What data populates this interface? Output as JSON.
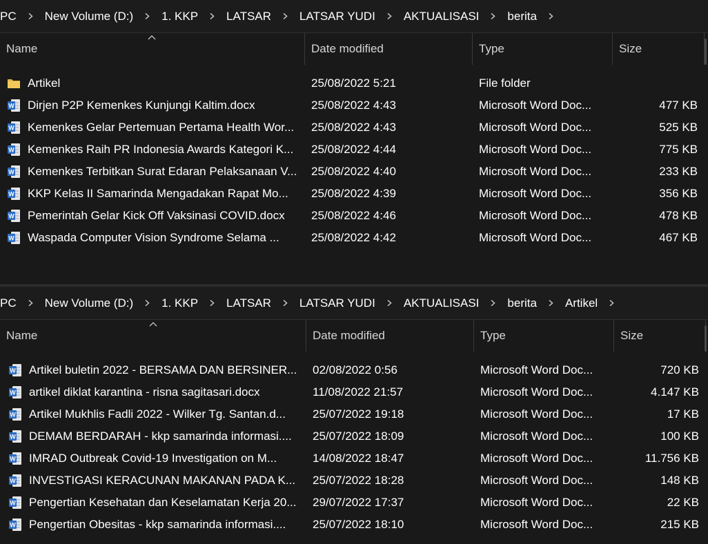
{
  "top_pane": {
    "breadcrumb": [
      "PC",
      "New Volume (D:)",
      "1. KKP",
      "LATSAR",
      "LATSAR YUDI",
      "AKTUALISASI",
      "berita"
    ],
    "columns": {
      "name": "Name",
      "date": "Date modified",
      "type": "Type",
      "size": "Size"
    },
    "rows": [
      {
        "icon": "folder-icon",
        "name": "Artikel",
        "date": "25/08/2022 5:21",
        "type": "File folder",
        "size": ""
      },
      {
        "icon": "word-doc-icon",
        "name": "Dirjen P2P Kemenkes Kunjungi Kaltim.docx",
        "date": "25/08/2022 4:43",
        "type": "Microsoft Word Doc...",
        "size": "477 KB"
      },
      {
        "icon": "word-doc-icon",
        "name": "Kemenkes Gelar Pertemuan Pertama Health Wor...",
        "date": "25/08/2022 4:43",
        "type": "Microsoft Word Doc...",
        "size": "525 KB"
      },
      {
        "icon": "word-doc-icon",
        "name": "Kemenkes Raih PR Indonesia Awards Kategori K...",
        "date": "25/08/2022 4:44",
        "type": "Microsoft Word Doc...",
        "size": "775 KB"
      },
      {
        "icon": "word-doc-icon",
        "name": "Kemenkes Terbitkan Surat Edaran Pelaksanaan V...",
        "date": "25/08/2022 4:40",
        "type": "Microsoft Word Doc...",
        "size": "233 KB"
      },
      {
        "icon": "word-doc-icon",
        "name": "KKP Kelas II Samarinda Mengadakan Rapat Mo...",
        "date": "25/08/2022 4:39",
        "type": "Microsoft Word Doc...",
        "size": "356 KB"
      },
      {
        "icon": "word-doc-icon",
        "name": "Pemerintah Gelar Kick Off Vaksinasi COVID.docx",
        "date": "25/08/2022 4:46",
        "type": "Microsoft Word Doc...",
        "size": "478 KB"
      },
      {
        "icon": "word-doc-icon",
        "name": "Waspada Computer Vision Syndrome Selama ...",
        "date": "25/08/2022 4:42",
        "type": "Microsoft Word Doc...",
        "size": "467 KB"
      }
    ]
  },
  "bottom_pane": {
    "breadcrumb": [
      "PC",
      "New Volume (D:)",
      "1. KKP",
      "LATSAR",
      "LATSAR YUDI",
      "AKTUALISASI",
      "berita",
      "Artikel"
    ],
    "columns": {
      "name": "Name",
      "date": "Date modified",
      "type": "Type",
      "size": "Size"
    },
    "rows": [
      {
        "icon": "word-doc-icon",
        "name": "Artikel buletin 2022 - BERSAMA DAN BERSINER...",
        "date": "02/08/2022 0:56",
        "type": "Microsoft Word Doc...",
        "size": "720 KB"
      },
      {
        "icon": "word-doc-icon",
        "name": "artikel diklat karantina - risna sagitasari.docx",
        "date": "11/08/2022 21:57",
        "type": "Microsoft Word Doc...",
        "size": "4.147 KB"
      },
      {
        "icon": "word-doc-icon",
        "name": "Artikel Mukhlis Fadli 2022 - Wilker Tg. Santan.d...",
        "date": "25/07/2022 19:18",
        "type": "Microsoft Word Doc...",
        "size": "17 KB"
      },
      {
        "icon": "word-doc-icon",
        "name": "DEMAM BERDARAH - kkp samarinda informasi....",
        "date": "25/07/2022 18:09",
        "type": "Microsoft Word Doc...",
        "size": "100 KB"
      },
      {
        "icon": "word-doc-icon",
        "name": "IMRAD Outbreak Covid-19 Investigation on M...",
        "date": "14/08/2022 18:47",
        "type": "Microsoft Word Doc...",
        "size": "11.756 KB"
      },
      {
        "icon": "word-doc-icon",
        "name": "INVESTIGASI KERACUNAN MAKANAN PADA K...",
        "date": "25/07/2022 18:28",
        "type": "Microsoft Word Doc...",
        "size": "148 KB"
      },
      {
        "icon": "word-doc-icon",
        "name": "Pengertian Kesehatan dan Keselamatan Kerja 20...",
        "date": "29/07/2022 17:37",
        "type": "Microsoft Word Doc...",
        "size": "22 KB"
      },
      {
        "icon": "word-doc-icon",
        "name": "Pengertian Obesitas - kkp samarinda informasi....",
        "date": "25/07/2022 18:10",
        "type": "Microsoft Word Doc...",
        "size": "215 KB"
      }
    ]
  },
  "colors": {
    "background": "#191919",
    "folder": "#e8b84a",
    "word_blue": "#2b6cc4",
    "text": "#ffffff"
  }
}
